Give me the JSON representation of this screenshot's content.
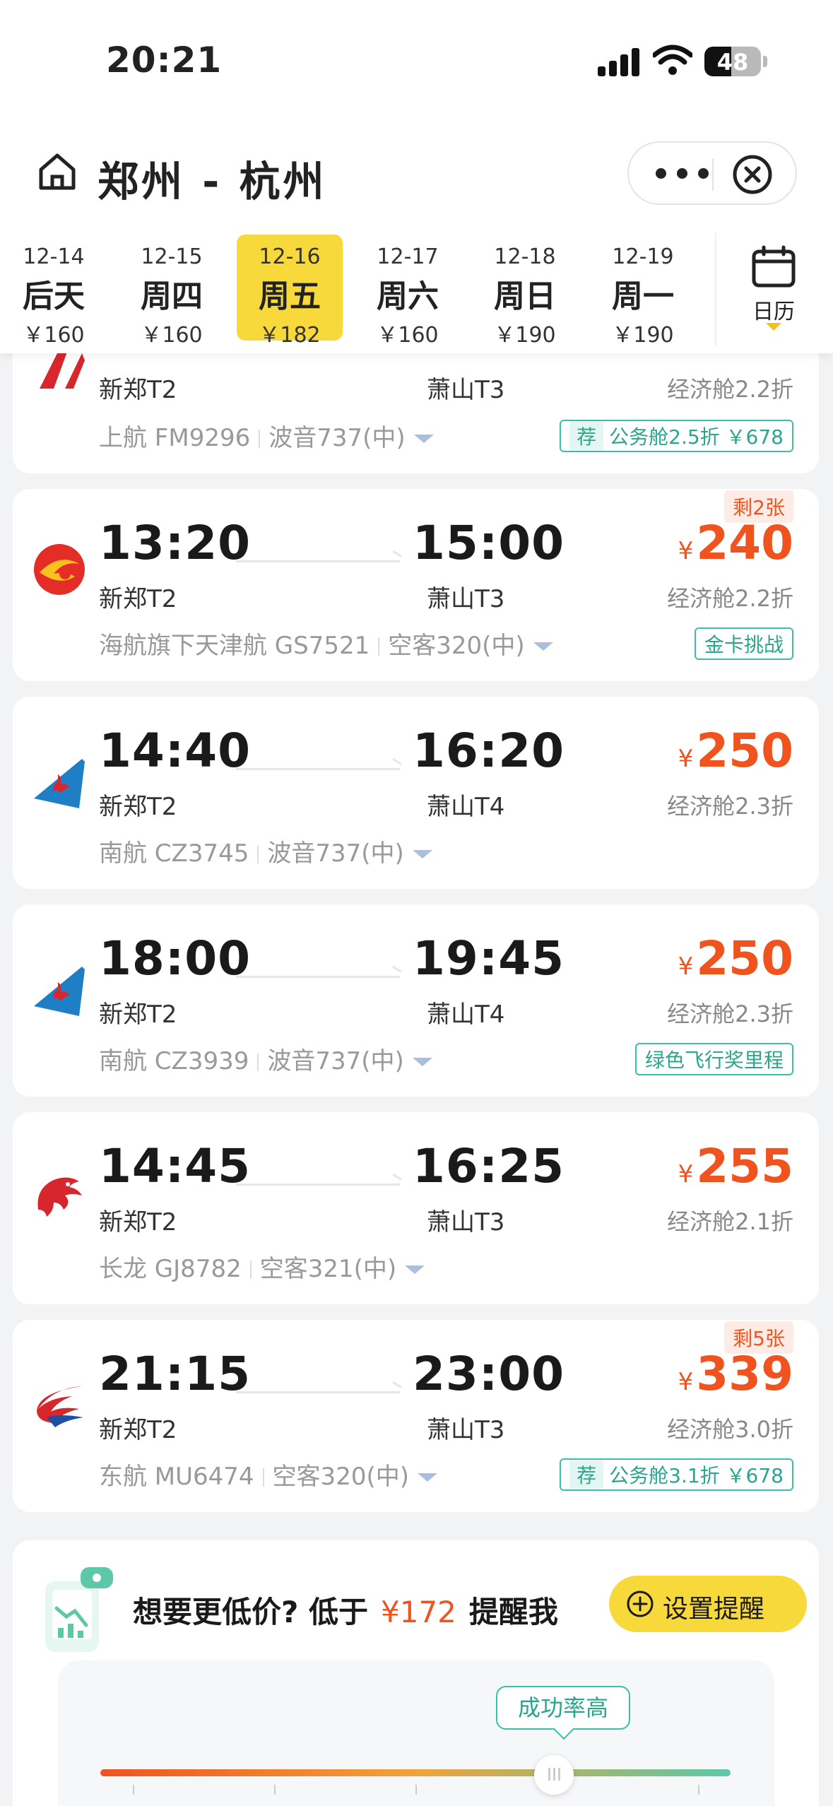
{
  "status_bar": {
    "time": "20:21",
    "battery": "48",
    "battery_level": 0.48
  },
  "header": {
    "route": "郑州 - 杭州"
  },
  "date_tabs": [
    {
      "date": "12-14",
      "weekday": "后天",
      "price": "￥160"
    },
    {
      "date": "12-15",
      "weekday": "周四",
      "price": "￥160"
    },
    {
      "date": "12-16",
      "weekday": "周五",
      "price": "￥182",
      "selected": true
    },
    {
      "date": "12-17",
      "weekday": "周六",
      "price": "￥160"
    },
    {
      "date": "12-18",
      "weekday": "周日",
      "price": "￥190"
    },
    {
      "date": "12-19",
      "weekday": "周一",
      "price": "￥190"
    }
  ],
  "calendar_label": "日历",
  "flights": [
    {
      "airline_logo": "shanghai-airlines-logo",
      "dep_airport": "新郑T2",
      "arr_airport": "萧山T3",
      "cabin": "经济舱2.2折",
      "airline": "上航 FM9296",
      "aircraft": "波音737(中)",
      "tag_rec": "荐",
      "tag": "公务舱2.5折 ￥678"
    },
    {
      "airline_logo": "tianjin-airlines-logo",
      "dep_time": "13:20",
      "arr_time": "15:00",
      "dep_airport": "新郑T2",
      "arr_airport": "萧山T3",
      "currency": "¥",
      "price": "240",
      "cabin": "经济舱2.2折",
      "airline": "海航旗下天津航 GS7521",
      "aircraft": "空客320(中)",
      "remain": "剩2张",
      "tag": "金卡挑战"
    },
    {
      "airline_logo": "china-southern-logo",
      "dep_time": "14:40",
      "arr_time": "16:20",
      "dep_airport": "新郑T2",
      "arr_airport": "萧山T4",
      "currency": "¥",
      "price": "250",
      "cabin": "经济舱2.3折",
      "airline": "南航 CZ3745",
      "aircraft": "波音737(中)"
    },
    {
      "airline_logo": "china-southern-logo",
      "dep_time": "18:00",
      "arr_time": "19:45",
      "dep_airport": "新郑T2",
      "arr_airport": "萧山T4",
      "currency": "¥",
      "price": "250",
      "cabin": "经济舱2.3折",
      "airline": "南航 CZ3939",
      "aircraft": "波音737(中)",
      "tag": "绿色飞行奖里程"
    },
    {
      "airline_logo": "loong-air-logo",
      "dep_time": "14:45",
      "arr_time": "16:25",
      "dep_airport": "新郑T2",
      "arr_airport": "萧山T3",
      "currency": "¥",
      "price": "255",
      "cabin": "经济舱2.1折",
      "airline": "长龙 GJ8782",
      "aircraft": "空客321(中)"
    },
    {
      "airline_logo": "china-eastern-logo",
      "dep_time": "21:15",
      "arr_time": "23:00",
      "dep_airport": "新郑T2",
      "arr_airport": "萧山T3",
      "currency": "¥",
      "price": "339",
      "cabin": "经济舱3.0折",
      "airline": "东航 MU6474",
      "aircraft": "空客320(中)",
      "remain": "剩5张",
      "tag_rec": "荐",
      "tag": "公务舱3.1折 ￥678"
    }
  ],
  "price_alert": {
    "q1": "想要更低价? 低于",
    "amount": "¥172",
    "q2": "提醒我",
    "button": "设置提醒",
    "bubble": "成功率高",
    "slider_level": 0.72
  },
  "colors": {
    "accent_yellow": "#f8d93c",
    "price_red": "#f0531e",
    "tag_green": "#2ba58e"
  }
}
